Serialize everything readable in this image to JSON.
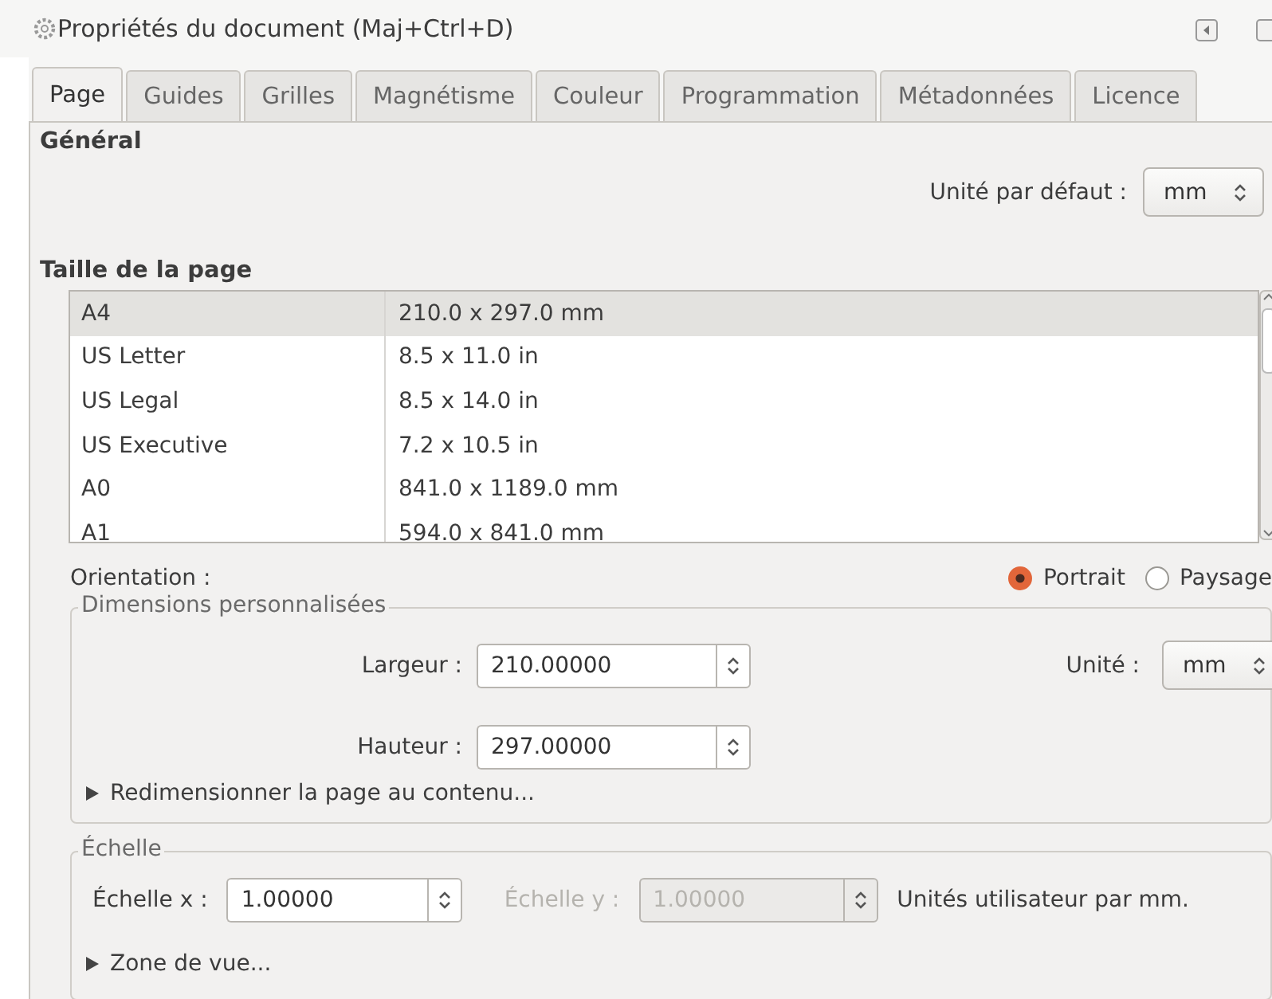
{
  "window": {
    "title": "Propriétés du document (Maj+Ctrl+D)"
  },
  "tabs": [
    {
      "label": "Page",
      "selected": true
    },
    {
      "label": "Guides",
      "selected": false
    },
    {
      "label": "Grilles",
      "selected": false
    },
    {
      "label": "Magnétisme",
      "selected": false
    },
    {
      "label": "Couleur",
      "selected": false
    },
    {
      "label": "Programmation",
      "selected": false
    },
    {
      "label": "Métadonnées",
      "selected": false
    },
    {
      "label": "Licence",
      "selected": false
    }
  ],
  "general": {
    "heading": "Général",
    "default_unit_label": "Unité par défaut :",
    "default_unit": "mm"
  },
  "page_size": {
    "heading": "Taille de la page",
    "rows": [
      {
        "name": "A4",
        "size": "210.0 x 297.0 mm",
        "selected": true
      },
      {
        "name": "US Letter",
        "size": "8.5 x 11.0 in",
        "selected": false
      },
      {
        "name": "US Legal",
        "size": "8.5 x 14.0 in",
        "selected": false
      },
      {
        "name": "US Executive",
        "size": "7.2 x 10.5 in",
        "selected": false
      },
      {
        "name": "A0",
        "size": "841.0 x 1189.0 mm",
        "selected": false
      },
      {
        "name": "A1",
        "size": "594.0 x 841.0 mm",
        "selected": false
      }
    ]
  },
  "orientation": {
    "label": "Orientation :",
    "options": [
      {
        "label": "Portrait",
        "selected": true
      },
      {
        "label": "Paysage",
        "selected": false
      }
    ]
  },
  "custom_dimensions": {
    "heading": "Dimensions personnalisées",
    "fields": [
      {
        "label": "Largeur :",
        "value": "210.00000"
      },
      {
        "label": "Hauteur :",
        "value": "297.00000"
      }
    ],
    "unit_label": "Unité :",
    "unit": "mm",
    "expander": {
      "label": "Redimensionner la page au contenu...",
      "expanded": false
    }
  },
  "scale": {
    "heading": "Échelle",
    "fields": [
      {
        "label": "Échelle x :",
        "value": "1.00000",
        "disabled": false
      },
      {
        "label": "Échelle y :",
        "value": "1.00000",
        "disabled": true
      }
    ],
    "units_note": "Unités utilisateur par mm.",
    "expander": {
      "label": "Zone de vue...",
      "expanded": false
    }
  }
}
